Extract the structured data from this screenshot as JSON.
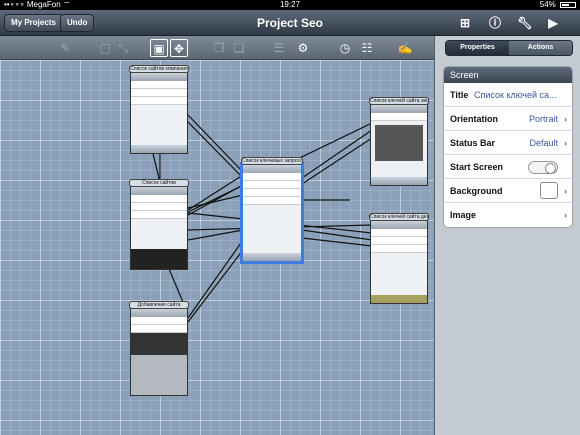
{
  "status_bar": {
    "carrier": "••∘∘∘ MegaFon ⌔",
    "time": "19:27",
    "battery": "54%"
  },
  "nav": {
    "my_projects": "My Projects",
    "undo": "Undo",
    "title": "Project Seo"
  },
  "canvas": {
    "screens": [
      {
        "label": "Список сайтов компания"
      },
      {
        "label": "Список сайтов"
      },
      {
        "label": "Добавление сайта"
      },
      {
        "label": "Список ключевых запросов"
      },
      {
        "label": "Список ключей сайта эволюция"
      },
      {
        "label": "Список ключей сайта действия"
      }
    ]
  },
  "panel": {
    "tabs": [
      "Properties",
      "Actions"
    ],
    "section": "Screen",
    "rows": [
      {
        "key": "Title",
        "value": "Список ключей са..."
      },
      {
        "key": "Orientation",
        "value": "Portrait"
      },
      {
        "key": "Status Bar",
        "value": "Default"
      },
      {
        "key": "Start Screen",
        "value": ""
      },
      {
        "key": "Background",
        "value": ""
      },
      {
        "key": "Image",
        "value": ""
      }
    ]
  }
}
